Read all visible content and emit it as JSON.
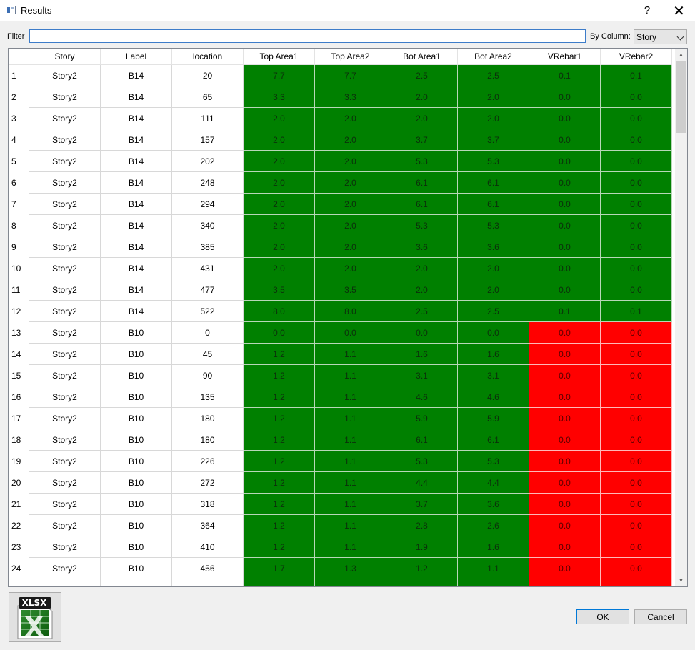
{
  "window": {
    "title": "Results",
    "help_symbol": "?",
    "close_symbol": "✕"
  },
  "filter": {
    "label": "Filter",
    "value": "",
    "by_column_label": "By Column:",
    "column_selected": "Story"
  },
  "table": {
    "columns": [
      "Story",
      "Label",
      "location",
      "Top Area1",
      "Top Area2",
      "Bot Area1",
      "Bot Area2",
      "VRebar1",
      "VRebar2"
    ],
    "status_colors": {
      "pass": "#008000",
      "fail": "#ff0000"
    },
    "rows": [
      {
        "n": "1",
        "story": "Story2",
        "label": "B14",
        "location": "20",
        "values": [
          "7.7",
          "7.7",
          "2.5",
          "2.5",
          "0.1",
          "0.1"
        ],
        "status": [
          "pass",
          "pass",
          "pass",
          "pass",
          "pass",
          "pass"
        ]
      },
      {
        "n": "2",
        "story": "Story2",
        "label": "B14",
        "location": "65",
        "values": [
          "3.3",
          "3.3",
          "2.0",
          "2.0",
          "0.0",
          "0.0"
        ],
        "status": [
          "pass",
          "pass",
          "pass",
          "pass",
          "pass",
          "pass"
        ]
      },
      {
        "n": "3",
        "story": "Story2",
        "label": "B14",
        "location": "111",
        "values": [
          "2.0",
          "2.0",
          "2.0",
          "2.0",
          "0.0",
          "0.0"
        ],
        "status": [
          "pass",
          "pass",
          "pass",
          "pass",
          "pass",
          "pass"
        ]
      },
      {
        "n": "4",
        "story": "Story2",
        "label": "B14",
        "location": "157",
        "values": [
          "2.0",
          "2.0",
          "3.7",
          "3.7",
          "0.0",
          "0.0"
        ],
        "status": [
          "pass",
          "pass",
          "pass",
          "pass",
          "pass",
          "pass"
        ]
      },
      {
        "n": "5",
        "story": "Story2",
        "label": "B14",
        "location": "202",
        "values": [
          "2.0",
          "2.0",
          "5.3",
          "5.3",
          "0.0",
          "0.0"
        ],
        "status": [
          "pass",
          "pass",
          "pass",
          "pass",
          "pass",
          "pass"
        ]
      },
      {
        "n": "6",
        "story": "Story2",
        "label": "B14",
        "location": "248",
        "values": [
          "2.0",
          "2.0",
          "6.1",
          "6.1",
          "0.0",
          "0.0"
        ],
        "status": [
          "pass",
          "pass",
          "pass",
          "pass",
          "pass",
          "pass"
        ]
      },
      {
        "n": "7",
        "story": "Story2",
        "label": "B14",
        "location": "294",
        "values": [
          "2.0",
          "2.0",
          "6.1",
          "6.1",
          "0.0",
          "0.0"
        ],
        "status": [
          "pass",
          "pass",
          "pass",
          "pass",
          "pass",
          "pass"
        ]
      },
      {
        "n": "8",
        "story": "Story2",
        "label": "B14",
        "location": "340",
        "values": [
          "2.0",
          "2.0",
          "5.3",
          "5.3",
          "0.0",
          "0.0"
        ],
        "status": [
          "pass",
          "pass",
          "pass",
          "pass",
          "pass",
          "pass"
        ]
      },
      {
        "n": "9",
        "story": "Story2",
        "label": "B14",
        "location": "385",
        "values": [
          "2.0",
          "2.0",
          "3.6",
          "3.6",
          "0.0",
          "0.0"
        ],
        "status": [
          "pass",
          "pass",
          "pass",
          "pass",
          "pass",
          "pass"
        ]
      },
      {
        "n": "10",
        "story": "Story2",
        "label": "B14",
        "location": "431",
        "values": [
          "2.0",
          "2.0",
          "2.0",
          "2.0",
          "0.0",
          "0.0"
        ],
        "status": [
          "pass",
          "pass",
          "pass",
          "pass",
          "pass",
          "pass"
        ]
      },
      {
        "n": "11",
        "story": "Story2",
        "label": "B14",
        "location": "477",
        "values": [
          "3.5",
          "3.5",
          "2.0",
          "2.0",
          "0.0",
          "0.0"
        ],
        "status": [
          "pass",
          "pass",
          "pass",
          "pass",
          "pass",
          "pass"
        ]
      },
      {
        "n": "12",
        "story": "Story2",
        "label": "B14",
        "location": "522",
        "values": [
          "8.0",
          "8.0",
          "2.5",
          "2.5",
          "0.1",
          "0.1"
        ],
        "status": [
          "pass",
          "pass",
          "pass",
          "pass",
          "pass",
          "pass"
        ]
      },
      {
        "n": "13",
        "story": "Story2",
        "label": "B10",
        "location": "0",
        "values": [
          "0.0",
          "0.0",
          "0.0",
          "0.0",
          "0.0",
          "0.0"
        ],
        "status": [
          "pass",
          "pass",
          "pass",
          "pass",
          "fail",
          "fail"
        ]
      },
      {
        "n": "14",
        "story": "Story2",
        "label": "B10",
        "location": "45",
        "values": [
          "1.2",
          "1.1",
          "1.6",
          "1.6",
          "0.0",
          "0.0"
        ],
        "status": [
          "pass",
          "pass",
          "pass",
          "pass",
          "fail",
          "fail"
        ]
      },
      {
        "n": "15",
        "story": "Story2",
        "label": "B10",
        "location": "90",
        "values": [
          "1.2",
          "1.1",
          "3.1",
          "3.1",
          "0.0",
          "0.0"
        ],
        "status": [
          "pass",
          "pass",
          "pass",
          "pass",
          "fail",
          "fail"
        ]
      },
      {
        "n": "16",
        "story": "Story2",
        "label": "B10",
        "location": "135",
        "values": [
          "1.2",
          "1.1",
          "4.6",
          "4.6",
          "0.0",
          "0.0"
        ],
        "status": [
          "pass",
          "pass",
          "pass",
          "pass",
          "fail",
          "fail"
        ]
      },
      {
        "n": "17",
        "story": "Story2",
        "label": "B10",
        "location": "180",
        "values": [
          "1.2",
          "1.1",
          "5.9",
          "5.9",
          "0.0",
          "0.0"
        ],
        "status": [
          "pass",
          "pass",
          "pass",
          "pass",
          "fail",
          "fail"
        ]
      },
      {
        "n": "18",
        "story": "Story2",
        "label": "B10",
        "location": "180",
        "values": [
          "1.2",
          "1.1",
          "6.1",
          "6.1",
          "0.0",
          "0.0"
        ],
        "status": [
          "pass",
          "pass",
          "pass",
          "pass",
          "fail",
          "fail"
        ]
      },
      {
        "n": "19",
        "story": "Story2",
        "label": "B10",
        "location": "226",
        "values": [
          "1.2",
          "1.1",
          "5.3",
          "5.3",
          "0.0",
          "0.0"
        ],
        "status": [
          "pass",
          "pass",
          "pass",
          "pass",
          "fail",
          "fail"
        ]
      },
      {
        "n": "20",
        "story": "Story2",
        "label": "B10",
        "location": "272",
        "values": [
          "1.2",
          "1.1",
          "4.4",
          "4.4",
          "0.0",
          "0.0"
        ],
        "status": [
          "pass",
          "pass",
          "pass",
          "pass",
          "fail",
          "fail"
        ]
      },
      {
        "n": "21",
        "story": "Story2",
        "label": "B10",
        "location": "318",
        "values": [
          "1.2",
          "1.1",
          "3.7",
          "3.6",
          "0.0",
          "0.0"
        ],
        "status": [
          "pass",
          "pass",
          "pass",
          "pass",
          "fail",
          "fail"
        ]
      },
      {
        "n": "22",
        "story": "Story2",
        "label": "B10",
        "location": "364",
        "values": [
          "1.2",
          "1.1",
          "2.8",
          "2.6",
          "0.0",
          "0.0"
        ],
        "status": [
          "pass",
          "pass",
          "pass",
          "pass",
          "fail",
          "fail"
        ]
      },
      {
        "n": "23",
        "story": "Story2",
        "label": "B10",
        "location": "410",
        "values": [
          "1.2",
          "1.1",
          "1.9",
          "1.6",
          "0.0",
          "0.0"
        ],
        "status": [
          "pass",
          "pass",
          "pass",
          "pass",
          "fail",
          "fail"
        ]
      },
      {
        "n": "24",
        "story": "Story2",
        "label": "B10",
        "location": "456",
        "values": [
          "1.7",
          "1.3",
          "1.2",
          "1.1",
          "0.0",
          "0.0"
        ],
        "status": [
          "pass",
          "pass",
          "pass",
          "pass",
          "fail",
          "fail"
        ]
      },
      {
        "n": "",
        "story": "",
        "label": "",
        "location": "",
        "values": [
          "",
          "",
          "",
          "",
          "",
          ""
        ],
        "status": [
          "pass",
          "pass",
          "pass",
          "pass",
          "fail",
          "fail"
        ]
      }
    ]
  },
  "export": {
    "icon": "xlsx-icon",
    "badge_text": "XLSX"
  },
  "buttons": {
    "ok": "OK",
    "cancel": "Cancel"
  }
}
